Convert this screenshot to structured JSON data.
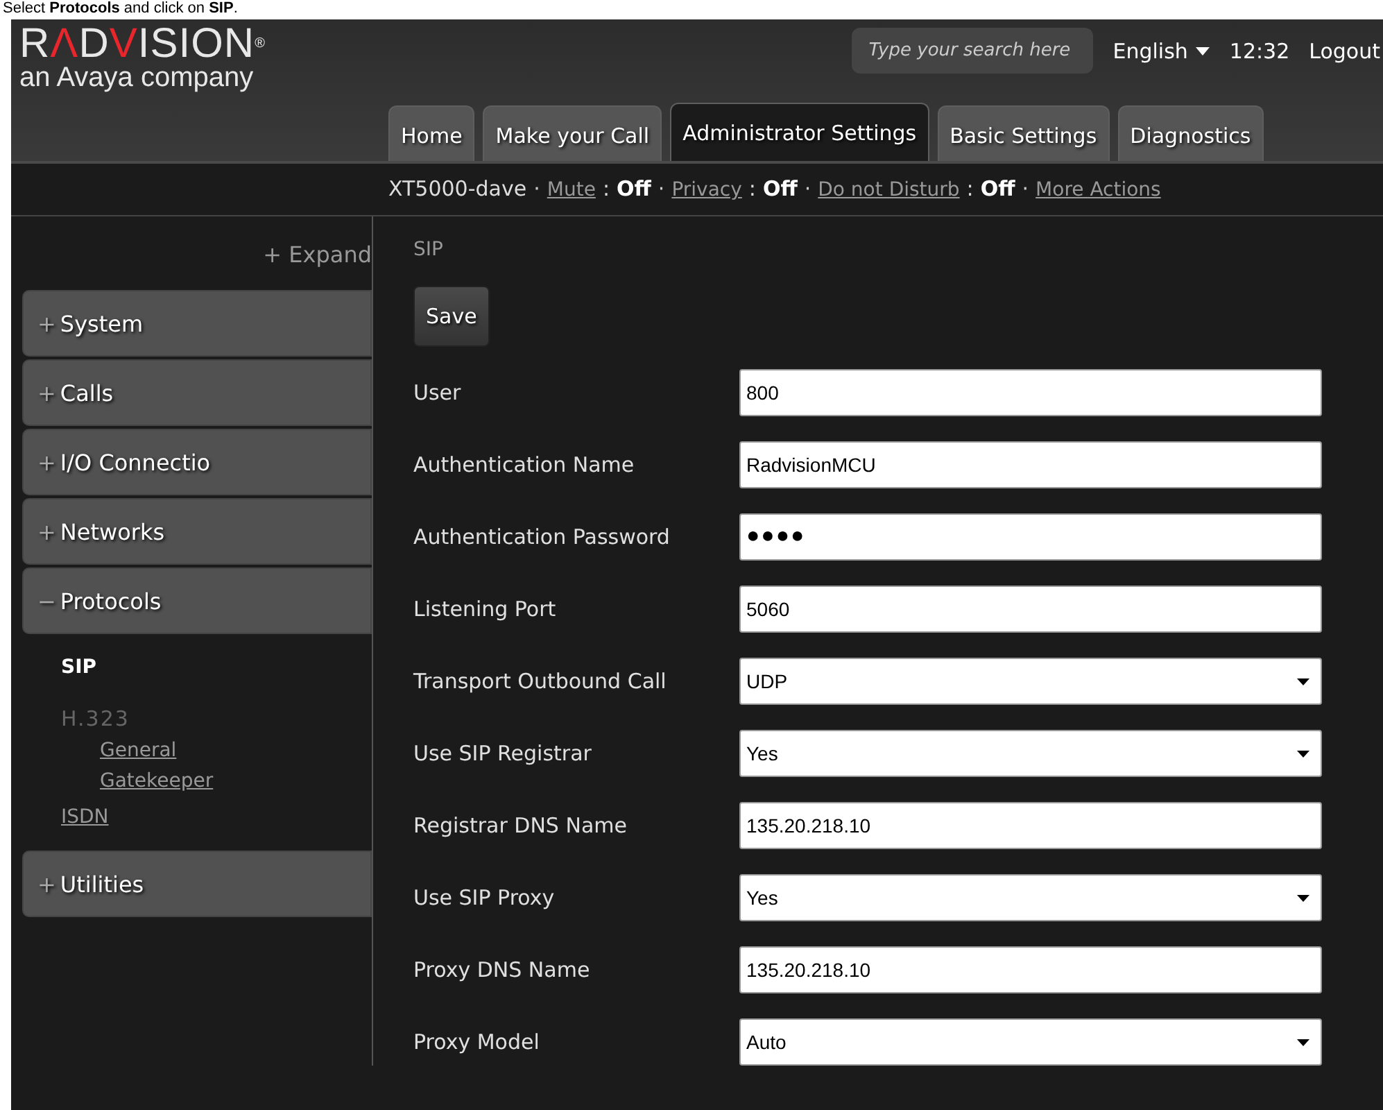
{
  "instruction": "Select **Protocols** and click on **SIP**.",
  "logo": {
    "parts": [
      {
        "text": "R",
        "accent": false
      },
      {
        "text": "Λ",
        "accent": true
      },
      {
        "text": "D",
        "accent": false
      },
      {
        "text": "V",
        "accent": true
      },
      {
        "text": "ISION",
        "accent": false
      }
    ],
    "mark": "®",
    "tagline": "an Avaya company"
  },
  "search": {
    "placeholder": "Type your search here"
  },
  "language": "English",
  "time": "12:32",
  "logout": "Logout",
  "tabs": [
    {
      "label": "Home",
      "selected": false
    },
    {
      "label": "Make your Call",
      "selected": false
    },
    {
      "label": "Administrator Settings",
      "selected": true
    },
    {
      "label": "Basic Settings",
      "selected": false
    },
    {
      "label": "Diagnostics",
      "selected": false
    }
  ],
  "status_bar": {
    "device": "XT5000-dave",
    "separator": "·",
    "colon": ":",
    "items": [
      {
        "label": "Mute",
        "value": "Off"
      },
      {
        "label": "Privacy",
        "value": "Off"
      },
      {
        "label": "Do not Disturb",
        "value": "Off"
      }
    ],
    "more": "More Actions"
  },
  "sidebar": {
    "expand": "+ Expand",
    "groups": [
      {
        "sign": "+",
        "label": "System"
      },
      {
        "sign": "+",
        "label": "Calls"
      },
      {
        "sign": "+",
        "label": "I/O Connectio"
      },
      {
        "sign": "+",
        "label": "Networks"
      },
      {
        "sign": "−",
        "label": "Protocols",
        "children": [
          {
            "kind": "link",
            "label": "SIP",
            "selected": true
          },
          {
            "kind": "heading",
            "label": "H.323",
            "selected": false,
            "children": [
              {
                "label": "General",
                "selected": false
              },
              {
                "label": "Gatekeeper",
                "selected": false
              }
            ]
          },
          {
            "kind": "link",
            "label": "ISDN",
            "selected": false
          }
        ]
      },
      {
        "sign": "+",
        "label": "Utilities"
      }
    ]
  },
  "page": {
    "title": "SIP",
    "save": "Save",
    "fields": [
      {
        "kind": "text",
        "label": "User",
        "value": "800"
      },
      {
        "kind": "text",
        "label": "Authentication Name",
        "value": "RadvisionMCU"
      },
      {
        "kind": "password",
        "label": "Authentication Password",
        "value": "●●●●"
      },
      {
        "kind": "text",
        "label": "Listening Port",
        "value": "5060"
      },
      {
        "kind": "select",
        "label": "Transport Outbound Call",
        "value": "UDP"
      },
      {
        "kind": "select",
        "label": "Use SIP Registrar",
        "value": "Yes"
      },
      {
        "kind": "text",
        "label": "Registrar DNS Name",
        "value": "135.20.218.10"
      },
      {
        "kind": "select",
        "label": "Use SIP Proxy",
        "value": "Yes"
      },
      {
        "kind": "text",
        "label": "Proxy DNS Name",
        "value": "135.20.218.10"
      },
      {
        "kind": "select",
        "label": "Proxy Model",
        "value": "Auto"
      }
    ]
  }
}
